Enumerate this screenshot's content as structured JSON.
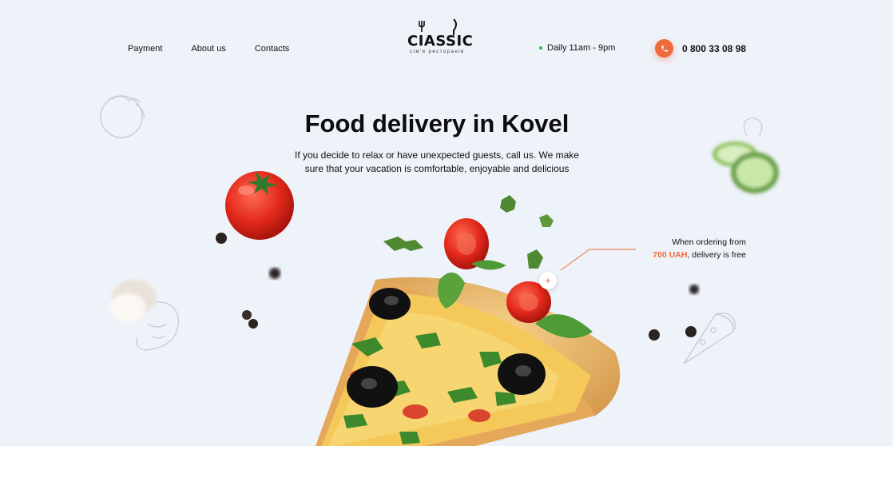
{
  "header": {
    "nav": [
      {
        "label": "Payment"
      },
      {
        "label": "About us"
      },
      {
        "label": "Contacts"
      }
    ],
    "logo": {
      "word": "CIASSIC",
      "sub": "сім'я ресторанів"
    },
    "hours": "Daily  11am - 9pm",
    "phone": "0 800 33 08 98"
  },
  "hero": {
    "title": "Food delivery in Kovel",
    "subtitle_line1": "If you decide to relax or have unexpected guests, call us. We make",
    "subtitle_line2": "sure that your vacation is comfortable, enjoyable and delicious"
  },
  "promo": {
    "line1": "When ordering from",
    "amount": "700 UAH",
    "line2_rest": ", delivery is free",
    "plus": "+"
  },
  "colors": {
    "accent": "#ef6a3a",
    "hero_bg": "#eef2f9",
    "hours_dot": "#37b24d"
  },
  "icons": [
    "phone-icon",
    "tomato-outline-icon",
    "mushroom-outline-icon",
    "pizza-outline-icon"
  ]
}
